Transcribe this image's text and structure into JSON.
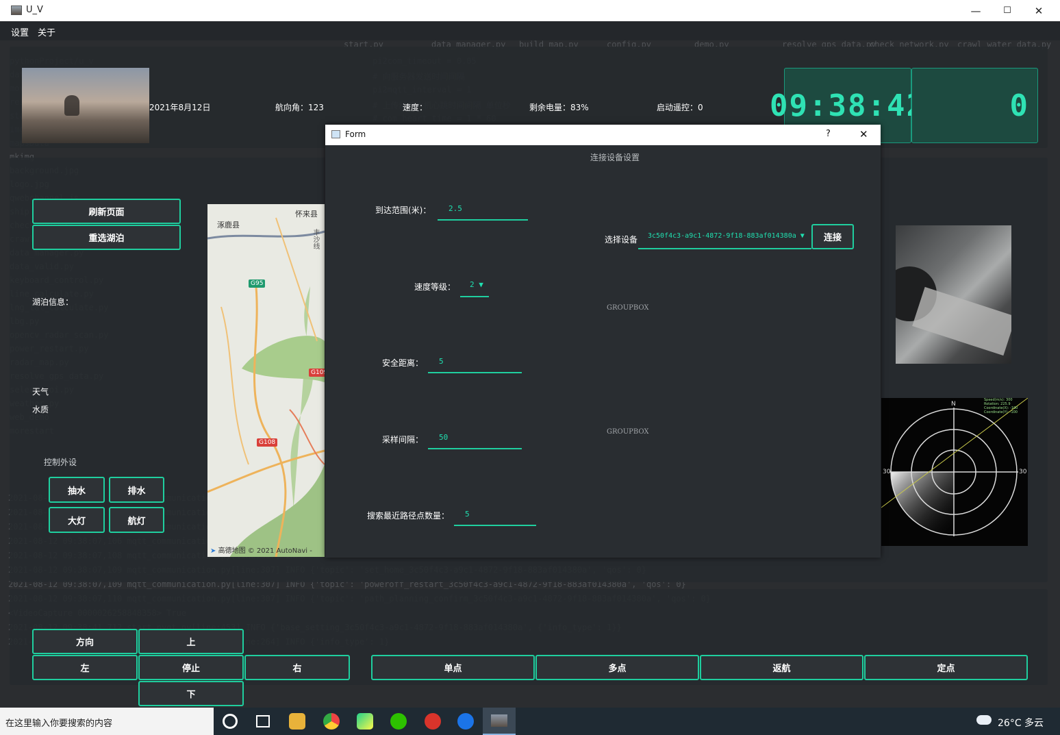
{
  "window": {
    "title": "U_V",
    "min": "—",
    "max": "☐",
    "close": "✕"
  },
  "menu": [
    "设置",
    "关于"
  ],
  "status": {
    "date": "2021年8月12日",
    "heading": "航向角：123",
    "speed": "速度：",
    "battery": "剩余电量：83%",
    "remote": "启动遥控：0"
  },
  "clock": {
    "time": "09:38:42",
    "counter": "0"
  },
  "left": {
    "refresh": "刷新页面",
    "reselect": "重选湖泊",
    "lake_info": "湖泊信息：",
    "weather": "天气",
    "water": "水质",
    "peripherals_title": "控制外设",
    "pump_in": "抽水",
    "pump_out": "排水",
    "headlight": "大灯",
    "navlight": "航灯"
  },
  "map": {
    "places": [
      "涿鹿县",
      "怀来县",
      "丰沙线"
    ],
    "roads": [
      "G95",
      "G109",
      "G108"
    ],
    "credit": "高德地图 © 2021 AutoNavi - "
  },
  "dialog": {
    "title": "Form",
    "help": "?",
    "close": "✕",
    "heading": "连接设备设置",
    "arrival_label": "到达范围(米)：",
    "arrival_value": "2.5",
    "speed_label": "速度等级：",
    "speed_value": "2",
    "safety_label": "安全距离：",
    "safety_value": "5",
    "sample_label": "采样间隔：",
    "sample_value": "50",
    "search_label": "搜索最近路径点数量：",
    "search_value": "5",
    "device_label": "选择设备",
    "device_value": "3c50f4c3-a9c1-4872-9f18-883af014380a",
    "connect": "连接",
    "groupbox1": "GROUPBOX",
    "groupbox2": "GROUPBOX"
  },
  "radar": {
    "north": "N",
    "left": "30",
    "right": "30",
    "readout": [
      "Speed(m/s): 300",
      "Rotation: 225.9",
      "Coordinate(X): -100",
      "Coordinate(Y): -100"
    ]
  },
  "bottom": {
    "direction": "方向",
    "up": "上",
    "left": "左",
    "stop": "停止",
    "right": "右",
    "down": "下",
    "single": "单点",
    "multi": "多点",
    "return": "返航",
    "fixed": "定点"
  },
  "taskbar": {
    "search": "在这里输入你要搜索的内容",
    "weather": "26°C  多云"
  },
  "ghost_log": [
    "2021-08-12 09:38:07,106 mqtt_communication.py[line:307] INFO",
    "2021-08-12 09:38:07,106 mqtt_communication.py[line:307] INFO",
    "2021-08-12 09:38:07,106 mqtt_communication.py[line:307] INFO",
    "2021-08-12 09:38:07,106 mqtt_communication.py[line:307] INFO",
    "2021-08-12 09:38:07,108 mqtt_communication.py[line:307] INFO",
    "2021-08-12 09:38:07,109 mqtt_communication.py[line:307] INFO {'topic': 'set_home_3c50f4c3-a9c1-4872-9f18-883af014380a', 'qos': 0}",
    "2021-08-12 09:38:07,109 mqtt_communication.py[line:307] INFO {'topic': 'poweroff_restart_3c50f4c3-a9c1-4872-9f18-883af014380a', 'qos': 0}",
    "2021-08-12 09:38:07,110 mqtt_communication.py[line:307] INFO {'topic': 'path_planning_confirm_3c50f4c3-a9c1-4872-9f18-883af014380a', 'qos': 0}",
    "<VideoCapture 0000026258848358> True",
    "2021-08-12 09:38:41,712 start_pyqt.py[line:453] INFO {'base_setting_3c50f4c3-a9c1-4872-9f18-883af014380a', {'info_type': 1}}",
    "2021-08-12 09:38:41,746 mqtt_communication.py[line:264] INFO {'info_type': 1}"
  ],
  "ghost_files": [
    "pythonProject/u_v",
    "dataManager",
    "move_control",
    "resources",
    "statics",
    "img",
    "mapsData",
    "mkimg",
    "background.jpg",
    "logo.jpg",
    "qwebchannel.js",
    "ship",
    "check_network.py",
    "crawl_water_data.py",
    "data_manager.py",
    "data_valid.py",
    "keyboard_control.py",
    "line_calculate.py",
    "lng_lat_calculate.py",
    "lbg.py",
    "opencv_radar_scan.py",
    "power_restart.py",
    "radar_map.py",
    "resolve_gps_data.py",
    "select_roi.py",
    "weather.py",
    "web_demo",
    "morestart"
  ],
  "ghost_tabs": [
    "start.py",
    "data_manager.py",
    "build_map.py",
    "config.py",
    "demo.py",
    "resolve_gps_data.py",
    "check_network.py",
    "crawl_water_data.py"
  ],
  "ghost_code": [
    "pi2com_timeout = 0.05",
    "# 向服务器发送时间间隔",
    "pi2mqtt_interval = 1",
    "# 上传给单片机心跳时间间隔 单位秒",
    "# com_heart_time = 1 * 60"
  ],
  "colors": {
    "accent": "#1fcf9f",
    "lcd": "#2fe2b4",
    "background": "#2b2d30"
  }
}
